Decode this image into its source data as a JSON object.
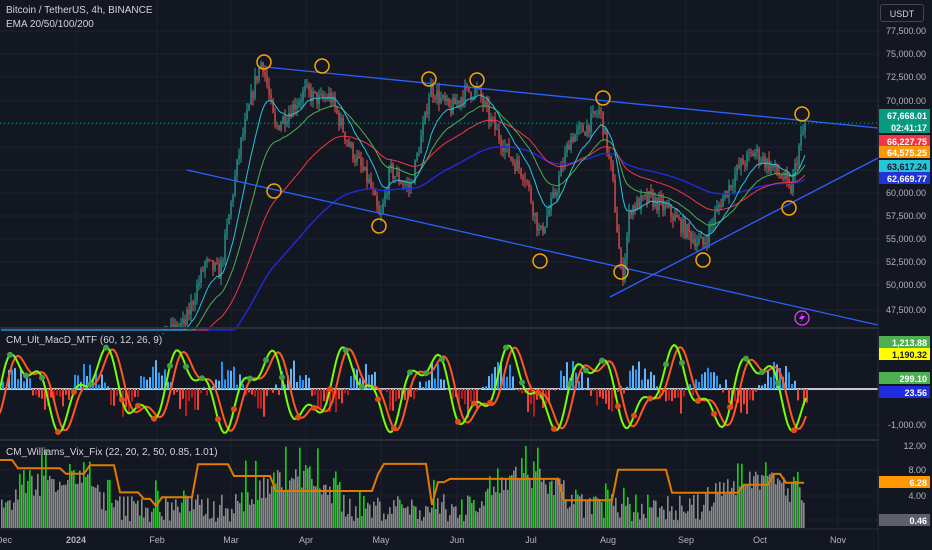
{
  "header": {
    "symbol_line": "Bitcoin / TetherUS, 4h, BINANCE",
    "indicator_line": "EMA 20/50/100/200",
    "currency_button": "USDT"
  },
  "price_axis": {
    "ticks": [
      "77,500.00",
      "75,000.00",
      "72,500.00",
      "70,000.00",
      "60,000.00",
      "57,500.00",
      "55,000.00",
      "52,500.00",
      "50,000.00",
      "47,500.00"
    ]
  },
  "price_badges": [
    {
      "label": "67,668.01",
      "color": "#089981",
      "text_color": "#ffffff"
    },
    {
      "label": "02:41:17",
      "color": "#089981",
      "text_color": "#ffffff"
    },
    {
      "label": "66,227.75",
      "color": "#f23645",
      "text_color": "#ffffff"
    },
    {
      "label": "64,575.25",
      "color": "#ff9800",
      "text_color": "#ffffff"
    },
    {
      "label": "63,617.24",
      "color": "#26c6da",
      "text_color": "#131722"
    },
    {
      "label": "62,669.77",
      "color": "#2133d6",
      "text_color": "#ffffff"
    }
  ],
  "macd_pane": {
    "label": "CM_Ult_MacD_MTF (60, 12, 26, 9)",
    "ticks": [
      "-1,000.00"
    ],
    "badges": [
      {
        "label": "1,213.88",
        "color": "#4caf50",
        "text_color": "#ffffff"
      },
      {
        "label": "1,190.32",
        "color": "#ffff00",
        "text_color": "#131722"
      },
      {
        "label": "299.10",
        "color": "#4caf50",
        "text_color": "#ffffff"
      },
      {
        "label": "23.56",
        "color": "#1e2bdf",
        "text_color": "#ffffff"
      }
    ]
  },
  "vix_pane": {
    "label": "CM_Williams_Vix_Fix (22, 20, 2, 50, 0.85, 1.01)",
    "ticks": [
      "12.00",
      "8.00",
      "4.00"
    ],
    "badges": [
      {
        "label": "6.28",
        "color": "#ff9800",
        "text_color": "#ffffff"
      },
      {
        "label": "0.46",
        "color": "#5d606b",
        "text_color": "#ffffff"
      }
    ]
  },
  "time_axis": {
    "labels": [
      "Dec",
      "2024",
      "Feb",
      "Mar",
      "Apr",
      "May",
      "Jun",
      "Jul",
      "Aug",
      "Sep",
      "Oct",
      "Nov"
    ]
  },
  "colors": {
    "background": "#131722",
    "trendline": "#2962ff",
    "pivot_circle": "#f7a600",
    "up_candle": "#26a69a",
    "down_candle": "#ef5350",
    "ema20": "#26c6da",
    "ema50": "#4caf50",
    "ema100": "#f23645",
    "ema200": "#1e2bdf"
  },
  "icons": {
    "alert_marker": "lightning-icon"
  }
}
